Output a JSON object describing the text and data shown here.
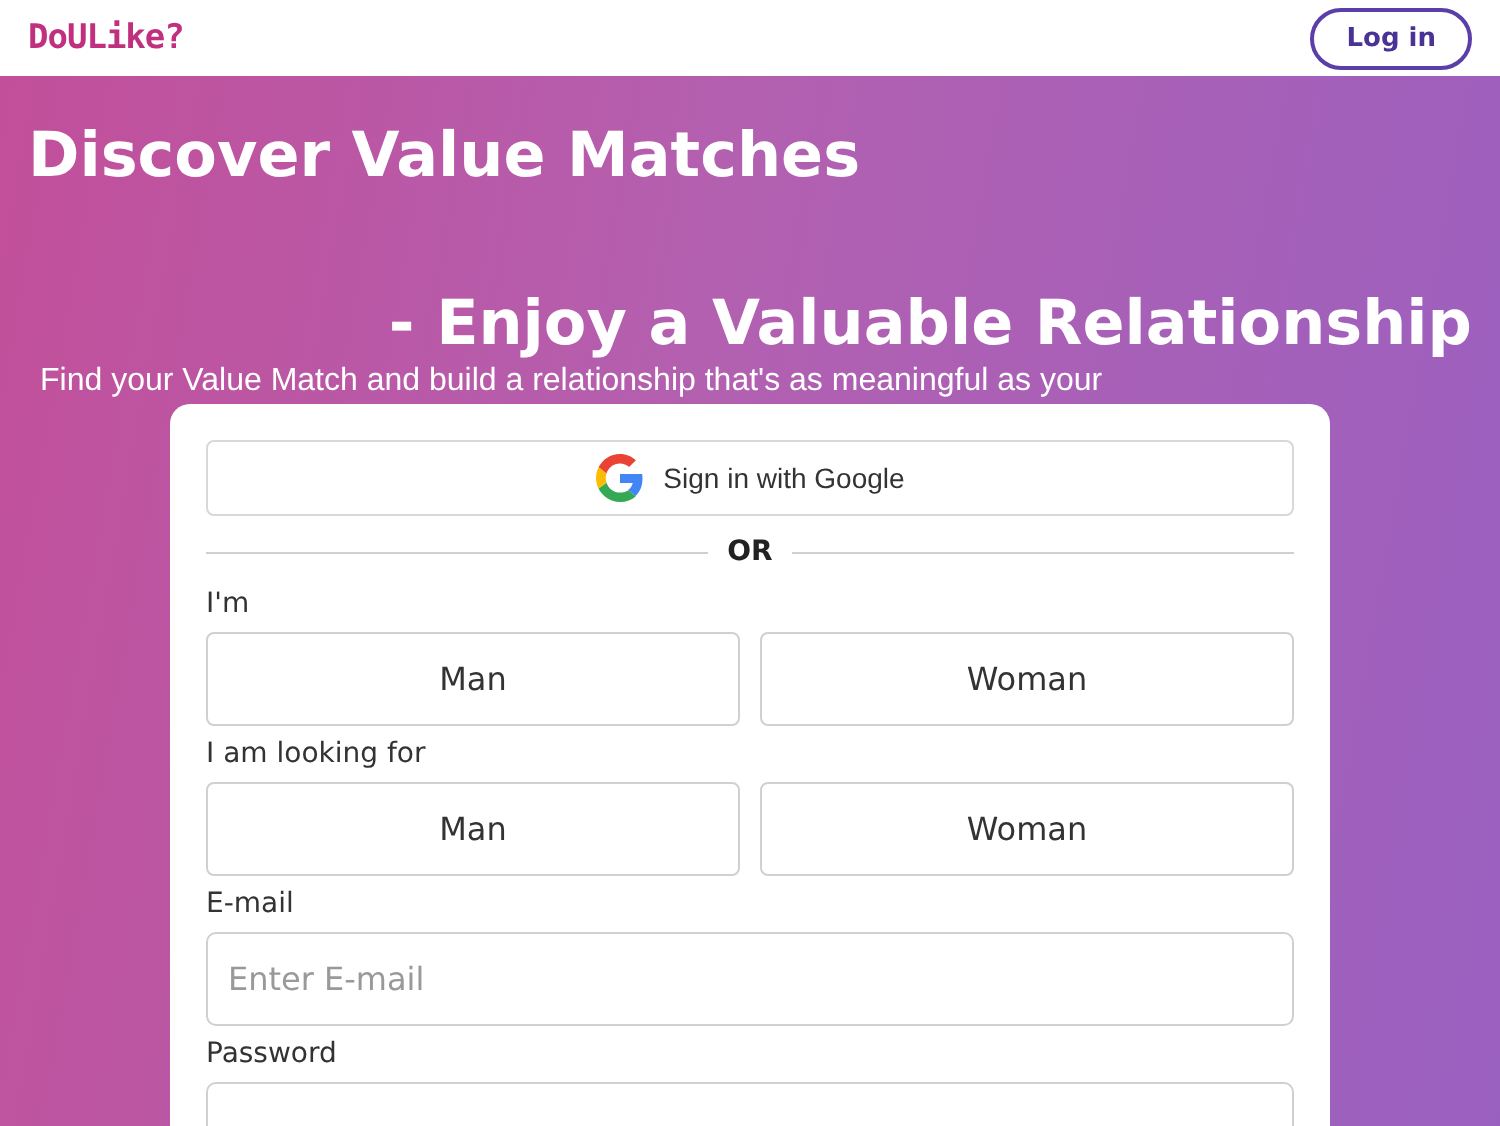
{
  "header": {
    "logo": "DoULike?",
    "login_button": "Log in"
  },
  "hero": {
    "title": "Discover Value Matches",
    "subtitle": "- Enjoy a Valuable Relationship",
    "tagline": "Find your Value Match and build a relationship that's as meaningful as your"
  },
  "form": {
    "google_button": "Sign in with Google",
    "divider": "OR",
    "groups": [
      {
        "label": "I'm",
        "options": [
          {
            "label": "Man",
            "selected": false
          },
          {
            "label": "Woman",
            "selected": false
          }
        ]
      },
      {
        "label": "I am looking for",
        "options": [
          {
            "label": "Man",
            "selected": false
          },
          {
            "label": "Woman",
            "selected": false
          }
        ]
      }
    ],
    "fields": [
      {
        "label": "E-mail",
        "placeholder": "Enter E-mail"
      },
      {
        "label": "Password"
      }
    ]
  }
}
